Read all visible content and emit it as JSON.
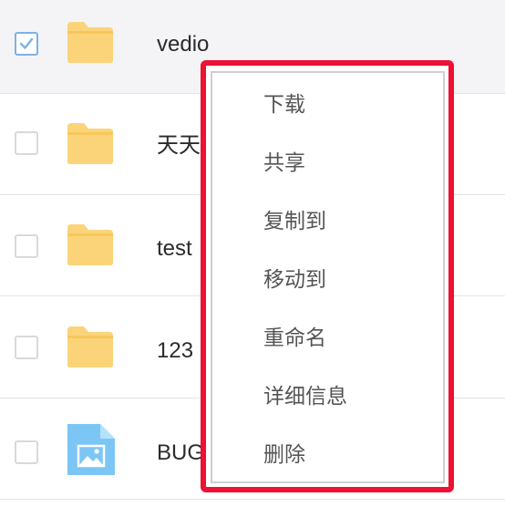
{
  "files": [
    {
      "name": "vedio",
      "type": "folder",
      "checked": true
    },
    {
      "name": "天天",
      "type": "folder",
      "checked": false
    },
    {
      "name": "test",
      "type": "folder",
      "checked": false
    },
    {
      "name": "123",
      "type": "folder",
      "checked": false
    },
    {
      "name": "BUG",
      "type": "image",
      "checked": false
    }
  ],
  "context_menu": {
    "items": [
      {
        "label": "下载"
      },
      {
        "label": "共享"
      },
      {
        "label": "复制到"
      },
      {
        "label": "移动到"
      },
      {
        "label": "重命名"
      },
      {
        "label": "详细信息"
      },
      {
        "label": "删除"
      }
    ],
    "highlight_color": "#ee1133"
  },
  "colors": {
    "folder": "#fbd47a",
    "image_file": "#7cc6f5",
    "checkbox_checked": "#7eb1e6"
  }
}
